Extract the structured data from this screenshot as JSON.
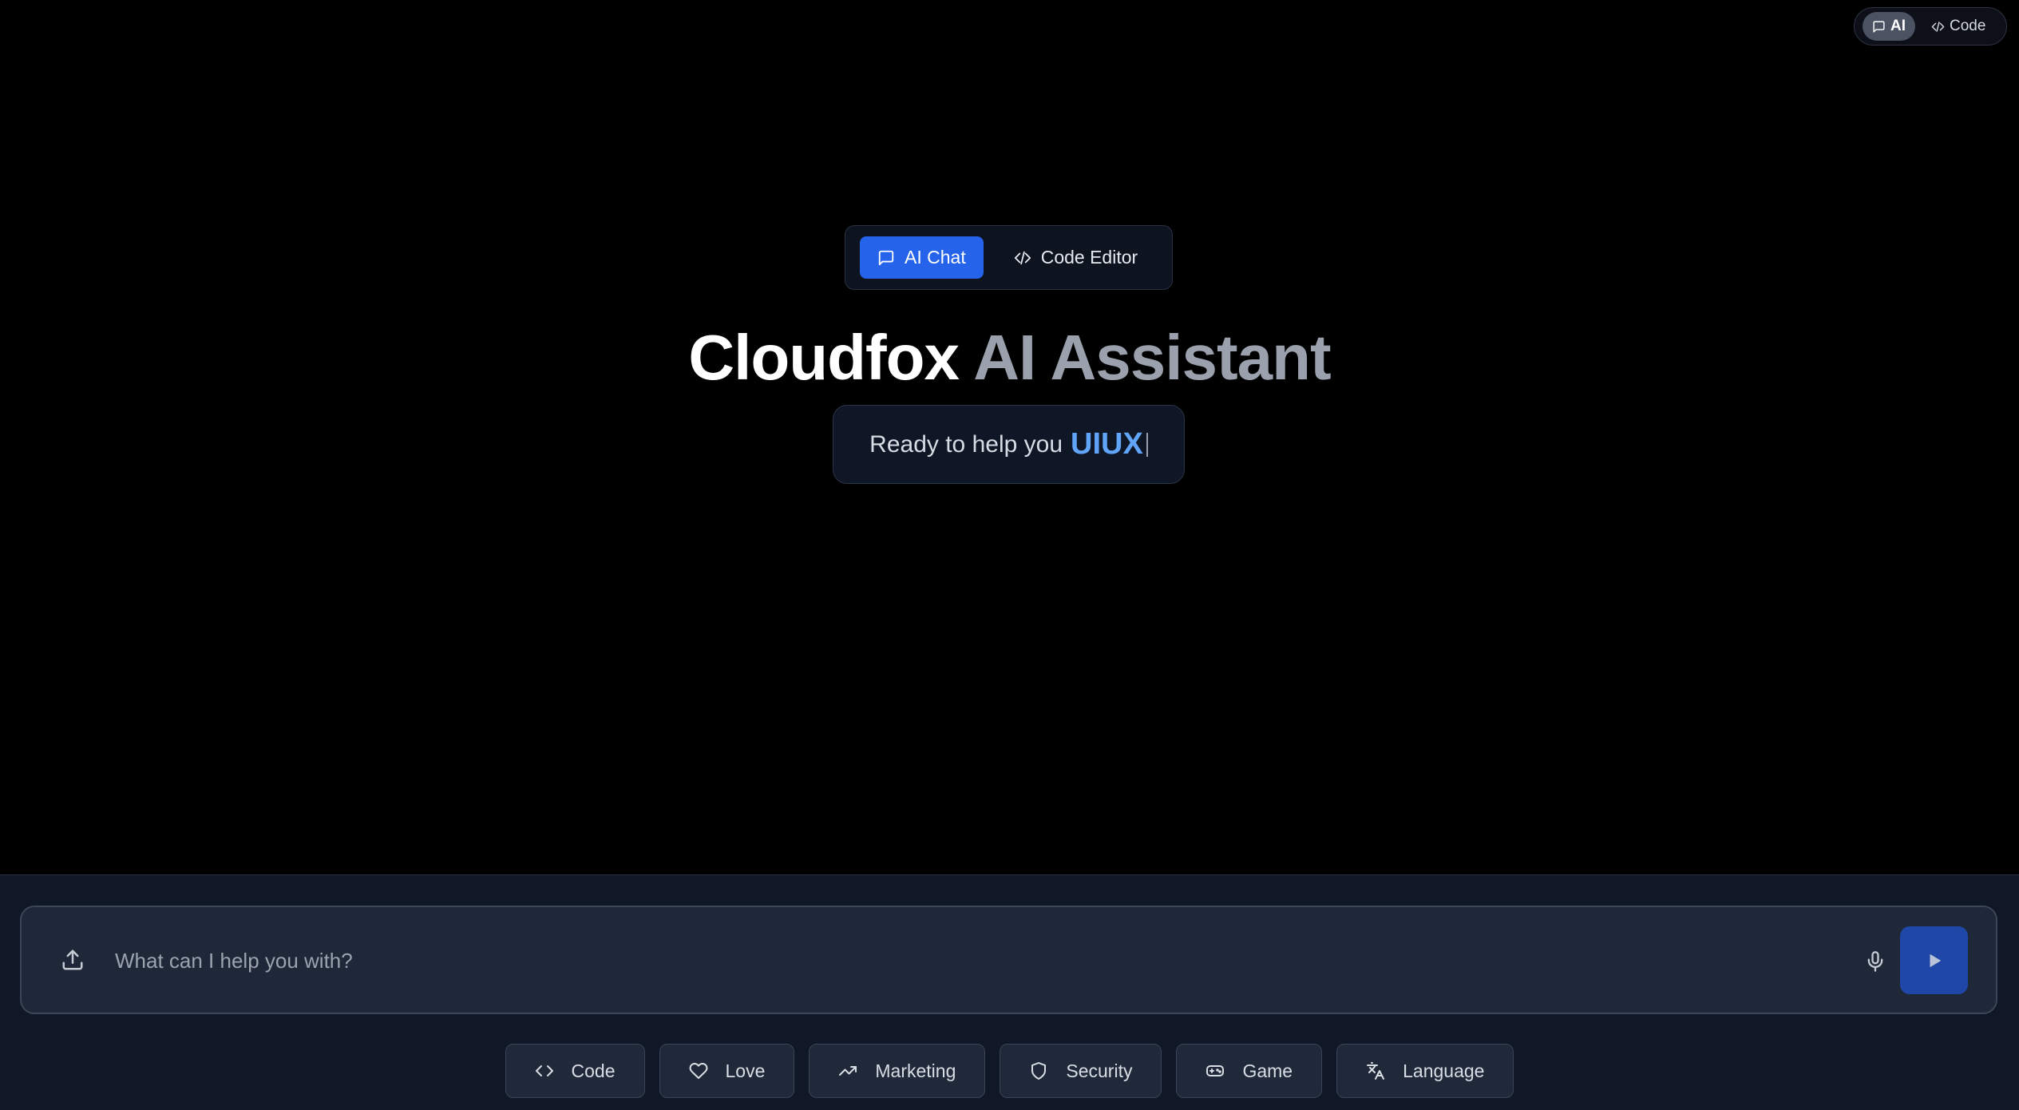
{
  "top_toggle": {
    "items": [
      {
        "label": "AI",
        "icon": "message-square-icon",
        "active": true
      },
      {
        "label": "Code",
        "icon": "code-icon",
        "active": false
      }
    ]
  },
  "hero": {
    "mode_switch": [
      {
        "label": "AI Chat",
        "icon": "message-square-icon",
        "active": true
      },
      {
        "label": "Code Editor",
        "icon": "code-icon",
        "active": false
      }
    ],
    "title_primary": "Cloudfox",
    "title_secondary": "AI Assistant",
    "subtitle_prefix": "Ready to help you",
    "subtitle_highlight": "UIUX"
  },
  "composer": {
    "placeholder": "What can I help you with?",
    "value": "",
    "upload_icon": "upload-icon",
    "mic_icon": "microphone-icon",
    "send_icon": "play-icon"
  },
  "chips": [
    {
      "label": "Code",
      "icon": "code-icon"
    },
    {
      "label": "Love",
      "icon": "heart-icon"
    },
    {
      "label": "Marketing",
      "icon": "trending-up-icon"
    },
    {
      "label": "Security",
      "icon": "shield-icon"
    },
    {
      "label": "Game",
      "icon": "gamepad-icon"
    },
    {
      "label": "Language",
      "icon": "languages-icon"
    }
  ],
  "colors": {
    "background": "#000000",
    "panel": "#101827",
    "accent": "#2563eb",
    "highlight": "#60a5fa",
    "send_button": "#1f47a8"
  }
}
